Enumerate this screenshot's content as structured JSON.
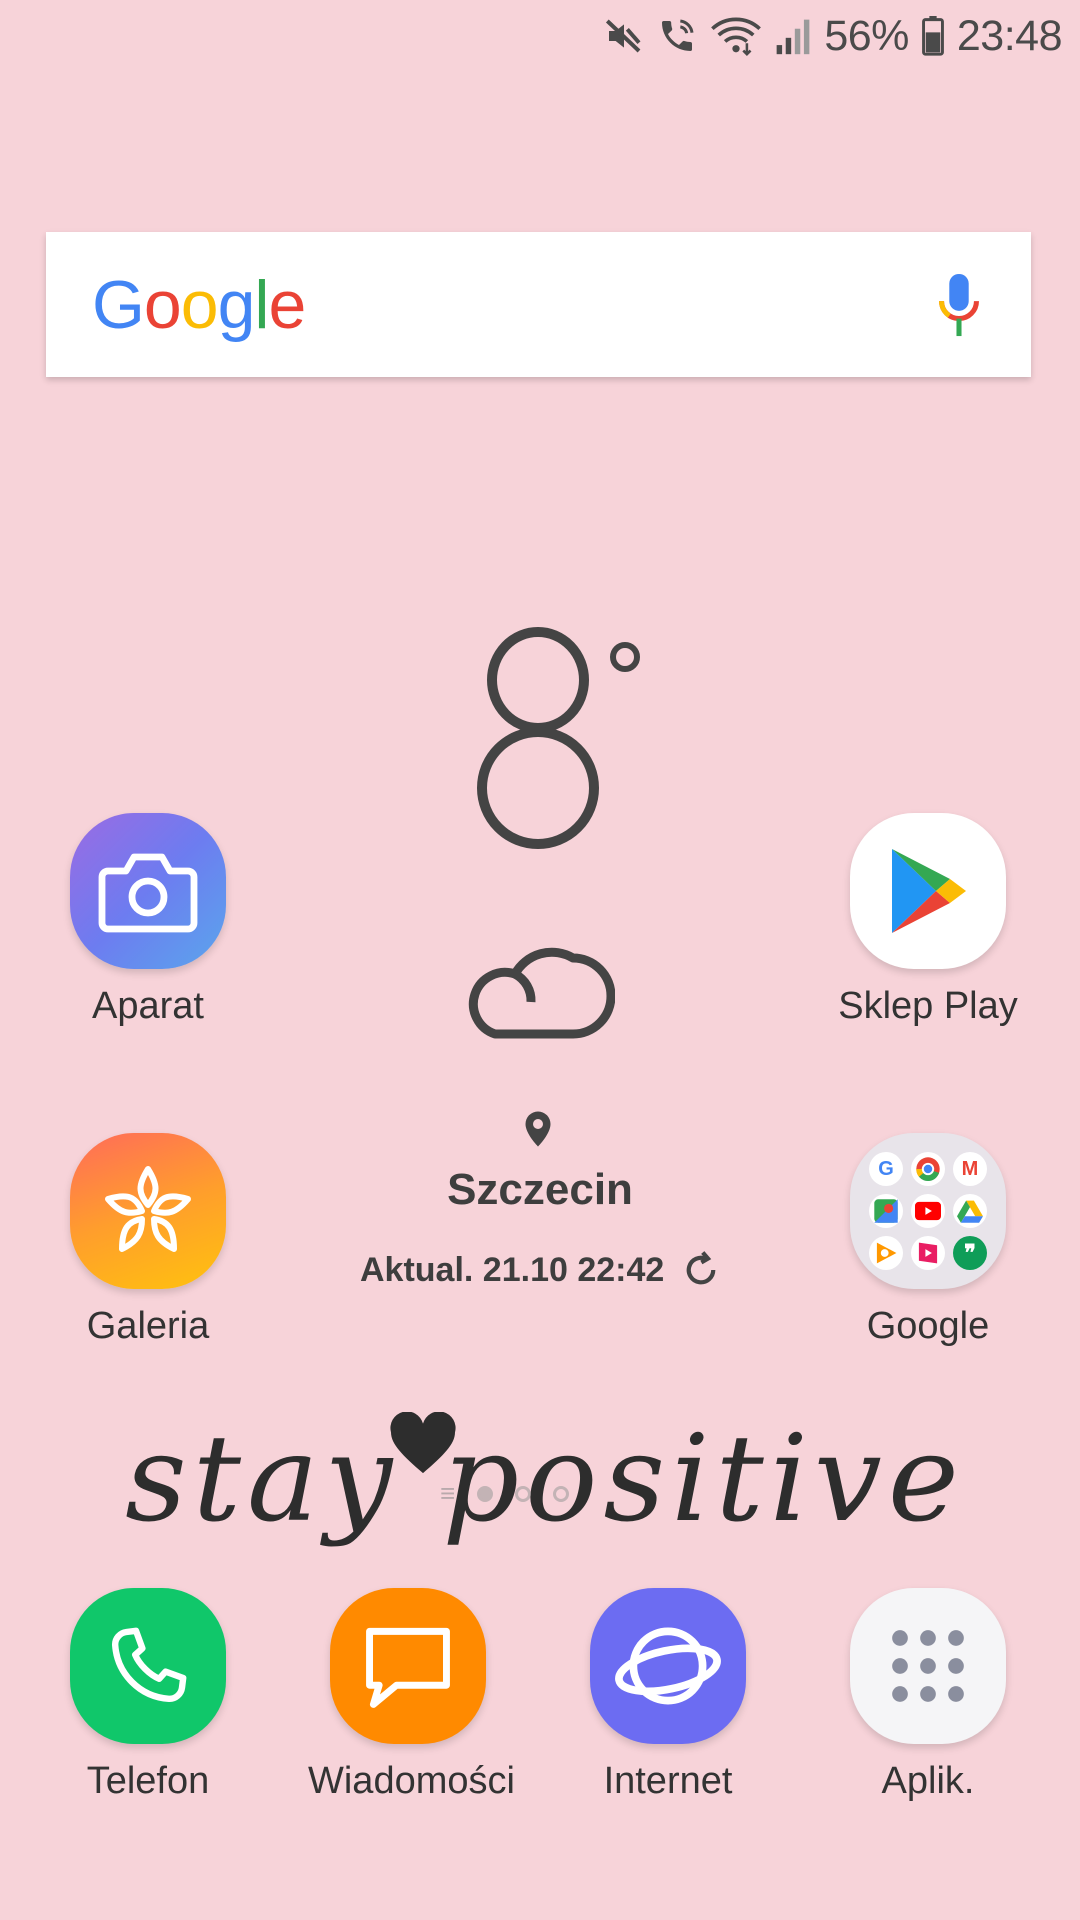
{
  "status_bar": {
    "battery": "56%",
    "time": "23:48",
    "icons": [
      "mute-icon",
      "wifi-calling-icon",
      "wifi-icon",
      "signal-icon",
      "battery-icon"
    ]
  },
  "search": {
    "logo": [
      "G",
      "o",
      "o",
      "g",
      "l",
      "e"
    ],
    "mic_icon": "mic-icon"
  },
  "weather": {
    "temperature": "8",
    "degree": "°",
    "condition_icon": "cloud-icon",
    "city": "Szczecin",
    "updated": "Aktual. 21.10 22:42",
    "refresh_icon": "refresh-icon"
  },
  "apps": {
    "camera": "Aparat",
    "play_store": "Sklep Play",
    "gallery": "Galeria",
    "google_folder": "Google"
  },
  "dock": {
    "phone": "Telefon",
    "messages": "Wiadomości",
    "internet": "Internet",
    "apps": "Aplik."
  },
  "wallpaper": {
    "text": "stay positive"
  },
  "colors": {
    "background": "#f7d3d9",
    "google_blue": "#4285f4",
    "google_red": "#ea4335",
    "google_yellow": "#fbbc05",
    "google_green": "#34a853"
  }
}
